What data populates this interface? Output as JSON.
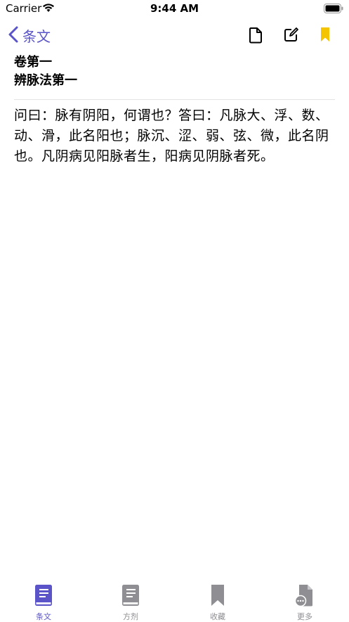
{
  "status_bar": {
    "carrier": "Carrier",
    "time": "9:44 AM"
  },
  "nav": {
    "back_label": "条文"
  },
  "content": {
    "volume": "卷第一",
    "chapter": "辨脉法第一",
    "paragraph": "问曰：脉有阴阳，何谓也？答曰：凡脉大、浮、数、动、滑，此名阳也；脉沉、涩、弱、弦、微，此名阴也。凡阴病见阳脉者生，阳病见阴脉者死。"
  },
  "tabs": [
    {
      "label": "条文",
      "icon": "book-icon",
      "active": true
    },
    {
      "label": "方剂",
      "icon": "book-icon",
      "active": false
    },
    {
      "label": "收藏",
      "icon": "bookmark-icon",
      "active": false
    },
    {
      "label": "更多",
      "icon": "document-more-icon",
      "active": false
    }
  ],
  "colors": {
    "accent": "#5a54c8",
    "bookmark": "#f5c400",
    "inactive": "#8e8e93"
  }
}
